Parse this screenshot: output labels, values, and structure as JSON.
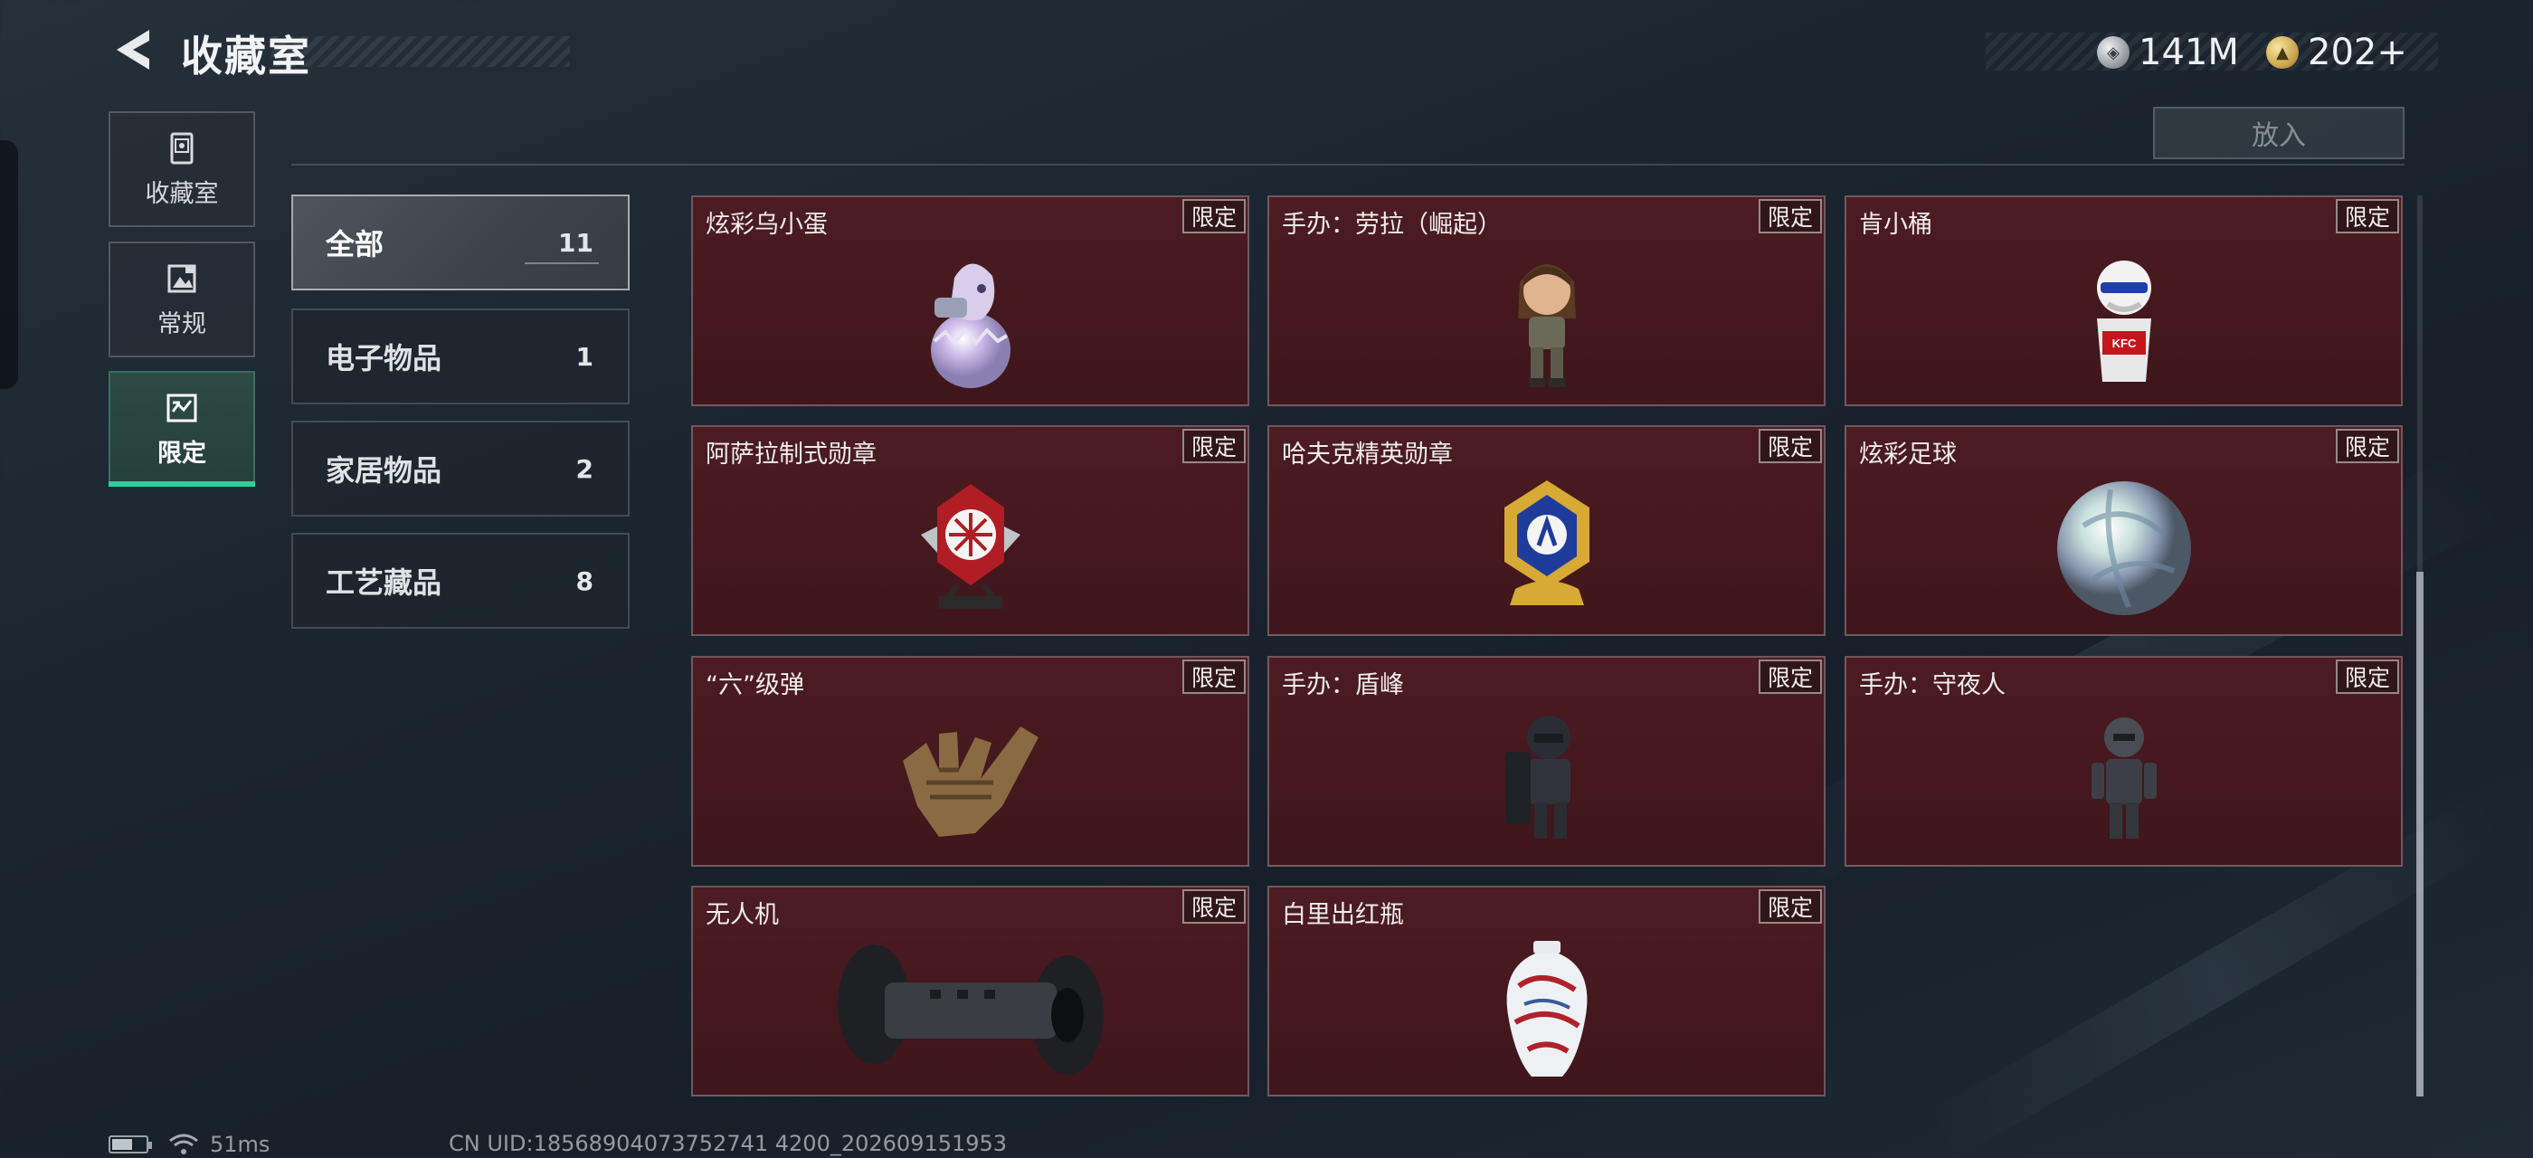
{
  "header": {
    "title": "收藏室",
    "currencies": [
      {
        "icon": "silver-coin-icon",
        "amount": "141M"
      },
      {
        "icon": "gold-coin-icon",
        "amount": "202+"
      }
    ]
  },
  "nav": {
    "items": [
      {
        "label": "收藏室",
        "icon": "trophy-case-icon"
      },
      {
        "label": "常规",
        "icon": "gallery-icon"
      },
      {
        "label": "限定",
        "icon": "limited-card-icon",
        "active": true
      }
    ]
  },
  "toolbar": {
    "faded_label": "",
    "put_button": "放入"
  },
  "categories": [
    {
      "name": "全部",
      "count": "11",
      "active": true
    },
    {
      "name": "电子物品",
      "count": "1"
    },
    {
      "name": "家居物品",
      "count": "2"
    },
    {
      "name": "工艺藏品",
      "count": "8"
    }
  ],
  "items": [
    {
      "name": "炫彩乌小蛋",
      "badge": "限定",
      "icon": "egg-figure-icon"
    },
    {
      "name": "手办：劳拉（崛起）",
      "badge": "限定",
      "icon": "figure-icon"
    },
    {
      "name": "肯小桶",
      "badge": "限定",
      "icon": "bucket-figure-icon"
    },
    {
      "name": "阿萨拉制式勋章",
      "badge": "限定",
      "icon": "medal-icon"
    },
    {
      "name": "哈夫克精英勋章",
      "badge": "限定",
      "icon": "gold-medal-icon"
    },
    {
      "name": "炫彩足球",
      "badge": "限定",
      "icon": "ball-icon"
    },
    {
      "name": "“六”级弹",
      "badge": "限定",
      "icon": "hand-sign-icon"
    },
    {
      "name": "手办：盾峰",
      "badge": "限定",
      "icon": "shield-figure-icon"
    },
    {
      "name": "手办：守夜人",
      "badge": "限定",
      "icon": "soldier-figure-icon"
    },
    {
      "name": "无人机",
      "badge": "限定",
      "icon": "drone-icon"
    },
    {
      "name": "白里出红瓶",
      "badge": "限定",
      "icon": "vase-icon"
    }
  ],
  "status": {
    "battery_level": 0.6,
    "latency": "51ms",
    "uid": "CN UID:18568904073752741 4200_202609151953"
  },
  "colors": {
    "accent": "#2ecf9a",
    "card_bg": "#4a1b21",
    "background": "#1c2630"
  }
}
